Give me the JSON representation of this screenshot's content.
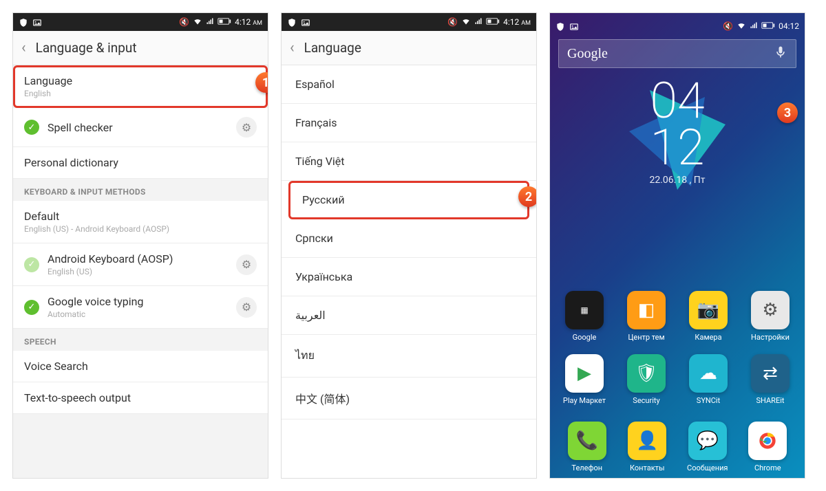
{
  "statusbar": {
    "time12": "4:12",
    "ampm": "AM",
    "time24": "04:12"
  },
  "panel1": {
    "header": "Language & input",
    "language_row": {
      "title": "Language",
      "sub": "English"
    },
    "spell_checker": "Spell checker",
    "personal_dict": "Personal dictionary",
    "section_keyboard": "KEYBOARD & INPUT METHODS",
    "default_row": {
      "title": "Default",
      "sub": "English (US) - Android Keyboard (AOSP)"
    },
    "aosp_row": {
      "title": "Android Keyboard (AOSP)",
      "sub": "English (US)"
    },
    "gvoice_row": {
      "title": "Google voice typing",
      "sub": "Automatic"
    },
    "section_speech": "SPEECH",
    "voice_search": "Voice Search",
    "tts": "Text-to-speech output"
  },
  "panel2": {
    "header": "Language",
    "items": [
      "Español",
      "Français",
      "Tiếng Việt",
      "Русский",
      "Српски",
      "Українська",
      "العربية",
      "ไทย",
      "中文 (简体)"
    ]
  },
  "panel3": {
    "search": "Google",
    "clock_top": "04",
    "clock_bot": "12",
    "date": "22.06.18 , Пт",
    "apps_row1": [
      {
        "label": "Google",
        "bg": "#1a1a1a"
      },
      {
        "label": "Центр тем",
        "bg": "#ff9c15"
      },
      {
        "label": "Камера",
        "bg": "#ffd21e"
      },
      {
        "label": "Настройки",
        "bg": "#e8e8e8"
      }
    ],
    "apps_row2": [
      {
        "label": "Play Маркет",
        "bg": "#ffffff"
      },
      {
        "label": "Security",
        "bg": "#1fb58a"
      },
      {
        "label": "SYNCit",
        "bg": "#1fb5cf"
      },
      {
        "label": "SHAREit",
        "bg": "#1f628a"
      }
    ],
    "dock": [
      {
        "label": "Телефон",
        "bg": "#7fd635"
      },
      {
        "label": "Контакты",
        "bg": "#ffd21e"
      },
      {
        "label": "Сообщения",
        "bg": "#27c0d6"
      },
      {
        "label": "Chrome",
        "bg": "#ffffff"
      }
    ]
  },
  "callouts": {
    "c1": "1",
    "c2": "2",
    "c3": "3"
  }
}
